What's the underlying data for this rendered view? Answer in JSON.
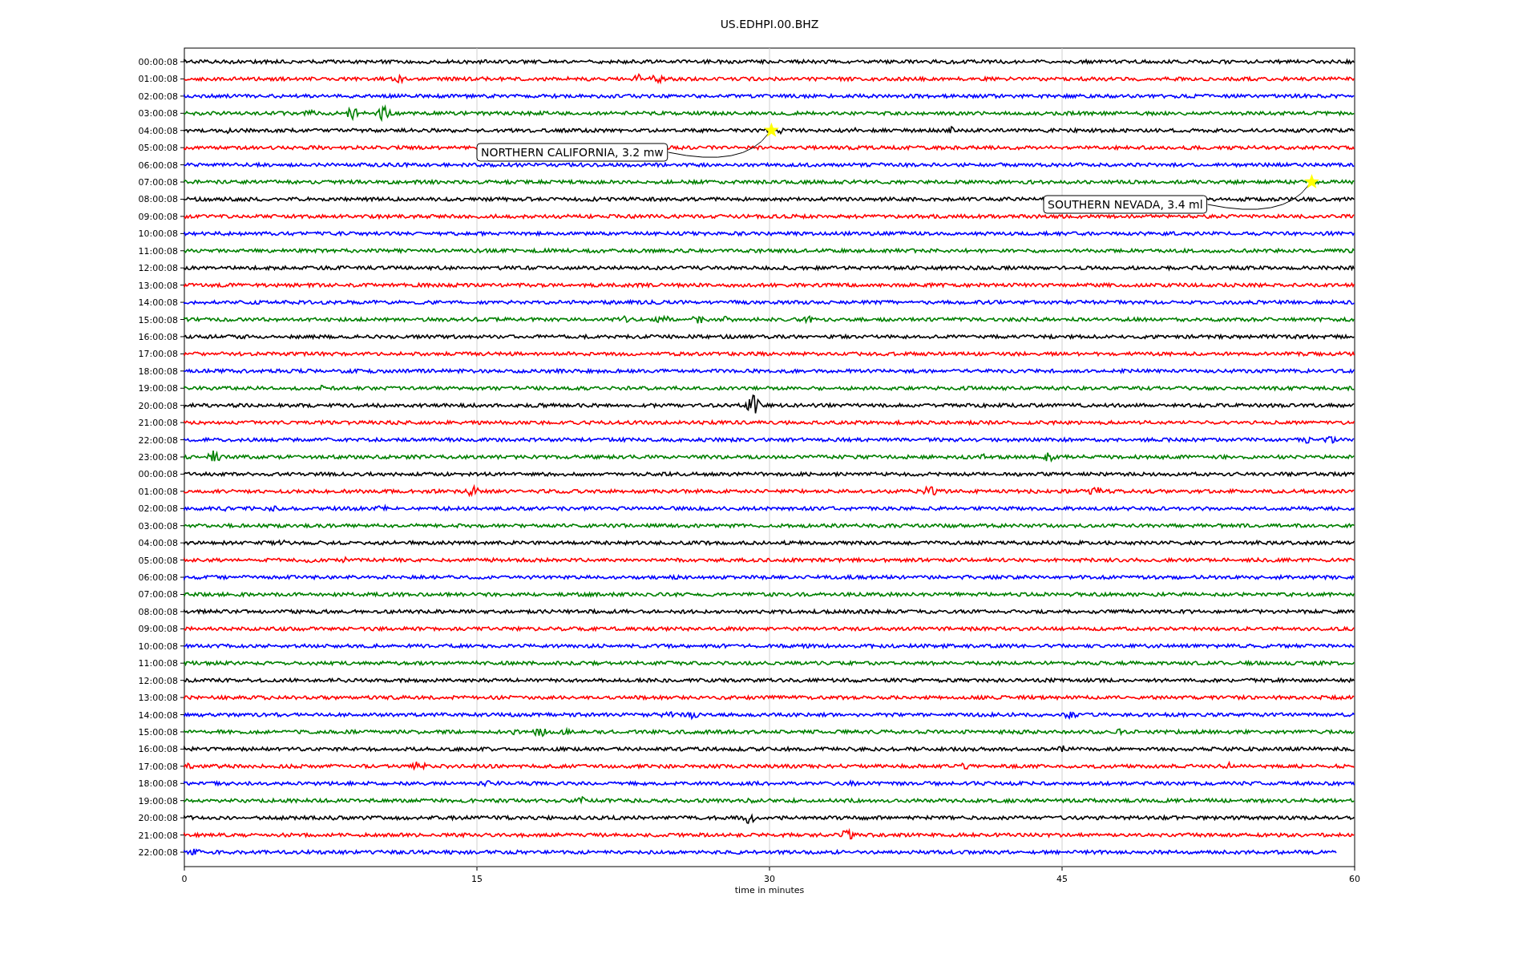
{
  "plot": {
    "title": "US.EDHPI.00.BHZ",
    "xlabel": "time in minutes",
    "xticks": [
      "0",
      "15",
      "30",
      "45",
      "60"
    ],
    "traces": [
      {
        "label": "00:00:08",
        "color": "#000000"
      },
      {
        "label": "01:00:08",
        "color": "#ff0000"
      },
      {
        "label": "02:00:08",
        "color": "#0000ff"
      },
      {
        "label": "03:00:08",
        "color": "#008000"
      },
      {
        "label": "04:00:08",
        "color": "#000000"
      },
      {
        "label": "05:00:08",
        "color": "#ff0000"
      },
      {
        "label": "06:00:08",
        "color": "#0000ff"
      },
      {
        "label": "07:00:08",
        "color": "#008000"
      },
      {
        "label": "08:00:08",
        "color": "#000000"
      },
      {
        "label": "09:00:08",
        "color": "#ff0000"
      },
      {
        "label": "10:00:08",
        "color": "#0000ff"
      },
      {
        "label": "11:00:08",
        "color": "#008000"
      },
      {
        "label": "12:00:08",
        "color": "#000000"
      },
      {
        "label": "13:00:08",
        "color": "#ff0000"
      },
      {
        "label": "14:00:08",
        "color": "#0000ff"
      },
      {
        "label": "15:00:08",
        "color": "#008000"
      },
      {
        "label": "16:00:08",
        "color": "#000000"
      },
      {
        "label": "17:00:08",
        "color": "#ff0000"
      },
      {
        "label": "18:00:08",
        "color": "#0000ff"
      },
      {
        "label": "19:00:08",
        "color": "#008000"
      },
      {
        "label": "20:00:08",
        "color": "#000000"
      },
      {
        "label": "21:00:08",
        "color": "#ff0000"
      },
      {
        "label": "22:00:08",
        "color": "#0000ff"
      },
      {
        "label": "23:00:08",
        "color": "#008000"
      },
      {
        "label": "00:00:08",
        "color": "#000000"
      },
      {
        "label": "01:00:08",
        "color": "#ff0000"
      },
      {
        "label": "02:00:08",
        "color": "#0000ff"
      },
      {
        "label": "03:00:08",
        "color": "#008000"
      },
      {
        "label": "04:00:08",
        "color": "#000000"
      },
      {
        "label": "05:00:08",
        "color": "#ff0000"
      },
      {
        "label": "06:00:08",
        "color": "#0000ff"
      },
      {
        "label": "07:00:08",
        "color": "#008000"
      },
      {
        "label": "08:00:08",
        "color": "#000000"
      },
      {
        "label": "09:00:08",
        "color": "#ff0000"
      },
      {
        "label": "10:00:08",
        "color": "#0000ff"
      },
      {
        "label": "11:00:08",
        "color": "#008000"
      },
      {
        "label": "12:00:08",
        "color": "#000000"
      },
      {
        "label": "13:00:08",
        "color": "#ff0000"
      },
      {
        "label": "14:00:08",
        "color": "#0000ff"
      },
      {
        "label": "15:00:08",
        "color": "#008000"
      },
      {
        "label": "16:00:08",
        "color": "#000000"
      },
      {
        "label": "17:00:08",
        "color": "#ff0000"
      },
      {
        "label": "18:00:08",
        "color": "#0000ff"
      },
      {
        "label": "19:00:08",
        "color": "#008000"
      },
      {
        "label": "20:00:08",
        "color": "#000000"
      },
      {
        "label": "21:00:08",
        "color": "#ff0000"
      },
      {
        "label": "22:00:08",
        "color": "#0000ff"
      }
    ],
    "annotations": [
      {
        "text": "NORTHERN CALIFORNIA, 3.2 mw"
      },
      {
        "text": "SOUTHERN NEVADA, 3.4 ml"
      }
    ]
  }
}
